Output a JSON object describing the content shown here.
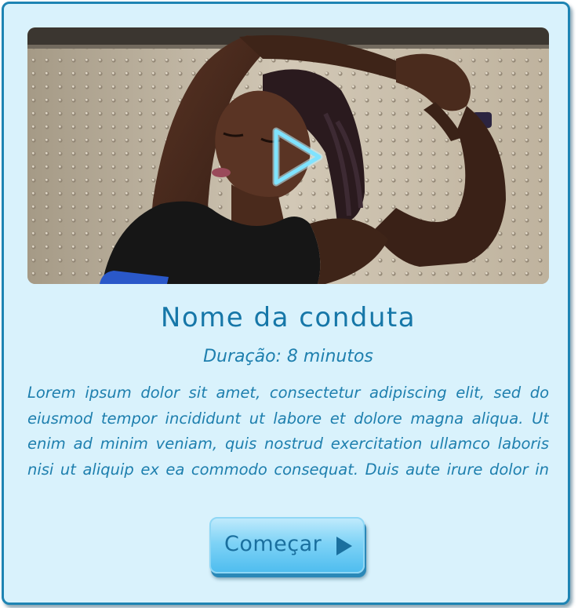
{
  "card": {
    "title": "Nome da conduta",
    "duration": "Duração: 8 minutos",
    "description": "Lorem ipsum dolor sit amet, consectetur adipiscing elit, sed do eiusmod tempor incididunt ut labore et dolore magna aliqua. Ut enim ad minim veniam, quis nostrud exercitation ullamco laboris nisi ut aliquip ex ea commodo consequat. Duis aute irure dolor in reprehenderit in voluptate velit esse cillum dolore eu fugiat nulla pariatur.",
    "start_label": "Começar",
    "start_icon": "play-arrow-icon",
    "media_icon": "play-icon"
  },
  "colors": {
    "card_background": "#d9f2fc",
    "card_border": "#1e84b3",
    "text": "#1e7fae",
    "play_overlay": "#7fe3ff"
  }
}
